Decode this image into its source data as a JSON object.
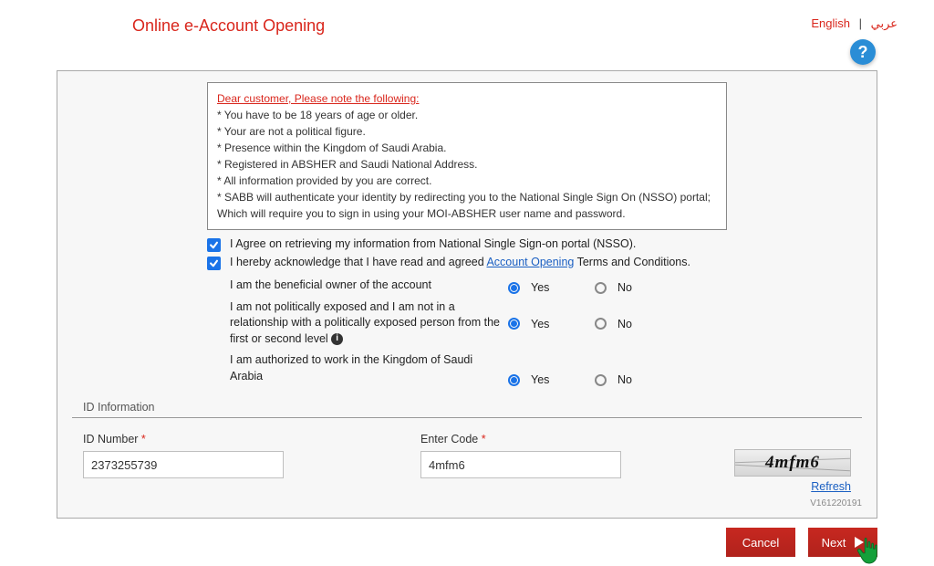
{
  "header": {
    "title": "Online e-Account Opening",
    "lang_en": "English",
    "lang_ar": "عربي",
    "lang_sep": "|"
  },
  "notice": {
    "heading": "Dear customer, Please note the following:",
    "b1": "* You have to be 18 years of age or older.",
    "b2": "* Your are not a political figure.",
    "b3": "* Presence within the Kingdom of Saudi Arabia.",
    "b4": "* Registered in ABSHER and Saudi National Address.",
    "b5": "* All information provided by you are correct.",
    "b6": "* SABB will authenticate your identity by redirecting you to the National Single Sign On (NSSO) portal; Which will require you to sign in using your MOI-ABSHER user name and password."
  },
  "consent": {
    "c1": "I Agree on retrieving my information from National Single Sign-on portal (NSSO).",
    "c2_pre": "I hereby acknowledge that I have read and agreed ",
    "c2_link": "Account Opening",
    "c2_post": " Terms and Conditions."
  },
  "questions": {
    "q1": "I am the beneficial owner of the account",
    "q2": "I am not politically exposed and I am not in a relationship with a politically exposed person from the first or second level",
    "q3": "I am authorized to work in the Kingdom of Saudi Arabia",
    "yes": "Yes",
    "no": "No"
  },
  "id_section": {
    "title": "ID Information",
    "id_label": "ID Number",
    "id_value": "2373255739",
    "code_label": "Enter Code",
    "code_value": "4mfm6",
    "captcha_text": "4mfm6",
    "refresh": "Refresh",
    "version": "V161220191"
  },
  "buttons": {
    "cancel": "Cancel",
    "next": "Next"
  }
}
